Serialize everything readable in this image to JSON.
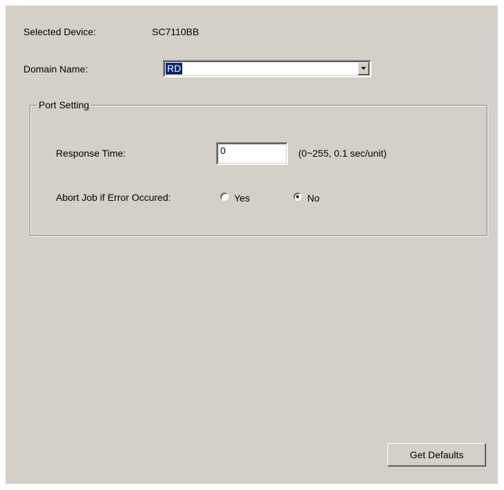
{
  "device": {
    "label": "Selected Device:",
    "value": "SC7110BB"
  },
  "domain": {
    "label": "Domain Name:",
    "selected": "RD"
  },
  "port_setting": {
    "title": "Port Setting",
    "response_time": {
      "label": "Response Time:",
      "value": "0",
      "hint": "(0~255, 0.1 sec/unit)"
    },
    "abort_job": {
      "label": "Abort Job if Error Occured:",
      "options": [
        {
          "label": "Yes",
          "checked": false
        },
        {
          "label": "No",
          "checked": true
        }
      ]
    }
  },
  "buttons": {
    "get_defaults": "Get Defaults"
  },
  "colors": {
    "panel_bg": "#d4d0c8",
    "selection_bg": "#0a246a",
    "selection_text": "#ffffff"
  },
  "icons": {
    "combo_arrow": "chevron-down-icon"
  }
}
